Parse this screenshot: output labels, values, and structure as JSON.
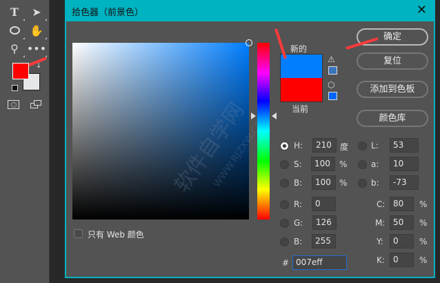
{
  "dialog": {
    "title": "拾色器（前景色）",
    "close_label": "✕"
  },
  "swatch": {
    "new_label": "新的",
    "current_label": "当前",
    "new_color": "#007eff",
    "current_color": "#ff0000",
    "websafe_color": "#3a75bd",
    "gamut_color": "#0066ff"
  },
  "buttons": {
    "ok": "确定",
    "reset": "复位",
    "add_swatch": "添加到色板",
    "libraries": "颜色库"
  },
  "web_only": {
    "label": "只有 Web 颜色",
    "checked": false
  },
  "fields": {
    "H": {
      "label": "H:",
      "value": "210",
      "unit": "度",
      "selected": true
    },
    "S": {
      "label": "S:",
      "value": "100",
      "unit": "%"
    },
    "Bv": {
      "label": "B:",
      "value": "100",
      "unit": "%"
    },
    "R": {
      "label": "R:",
      "value": "0"
    },
    "G": {
      "label": "G:",
      "value": "126"
    },
    "B": {
      "label": "B:",
      "value": "255"
    },
    "L": {
      "label": "L:",
      "value": "53"
    },
    "a": {
      "label": "a:",
      "value": "10"
    },
    "b": {
      "label": "b:",
      "value": "-73"
    },
    "C": {
      "label": "C:",
      "value": "80",
      "unit": "%"
    },
    "M": {
      "label": "M:",
      "value": "50",
      "unit": "%"
    },
    "Y": {
      "label": "Y:",
      "value": "0",
      "unit": "%"
    },
    "K": {
      "label": "K:",
      "value": "0",
      "unit": "%"
    }
  },
  "hex": {
    "label": "#",
    "value": "007eff"
  },
  "toolbar": {
    "foreground": "#ff0000",
    "background": "#e4e8e8",
    "text_tool": "T"
  },
  "watermark": {
    "text": "软件自学网",
    "url": "WWW.RJZXW.COM"
  }
}
